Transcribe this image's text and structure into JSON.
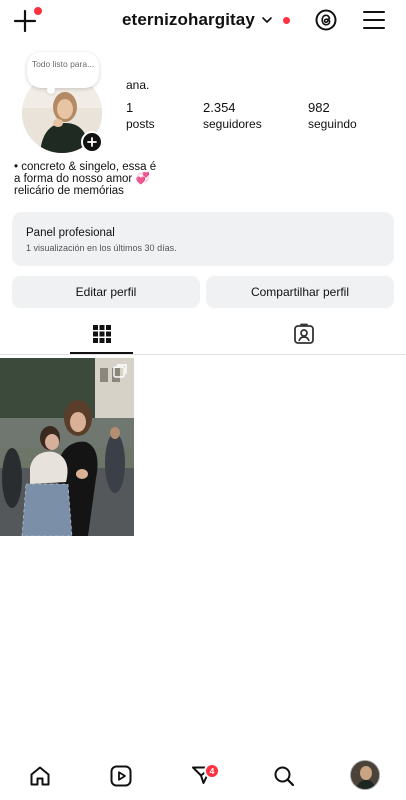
{
  "header": {
    "username": "eternizohargitay",
    "icons": [
      "plus-icon",
      "chevron-down-icon",
      "threads-icon",
      "menu-icon"
    ],
    "notification_color": "#ff3040"
  },
  "profile": {
    "note": "Todo listo para...",
    "display_name": "ana.",
    "stats": {
      "posts": {
        "value": "1",
        "label": "posts"
      },
      "followers": {
        "value": "2.354",
        "label": "seguidores"
      },
      "following": {
        "value": "982",
        "label": "seguindo"
      }
    },
    "bio": [
      "• concreto & singelo, essa é",
      "a forma do nosso amor 💞",
      "relicário de memórias"
    ]
  },
  "panel": {
    "title": "Panel profesional",
    "subtitle": "1 visualización en los últimos 30 días."
  },
  "actions": {
    "edit_label": "Editar perfil",
    "share_label": "Compartilhar perfil"
  },
  "tabs": [
    {
      "name": "grid",
      "icon": "grid-icon",
      "active": true
    },
    {
      "name": "tagged",
      "icon": "tagged-icon",
      "active": false
    }
  ],
  "posts": [
    {
      "icon": "carousel-icon"
    }
  ],
  "bottom_nav": {
    "items": [
      "home-icon",
      "reels-icon",
      "send-icon",
      "search-icon",
      "profile-avatar"
    ],
    "messages_badge": "4"
  }
}
